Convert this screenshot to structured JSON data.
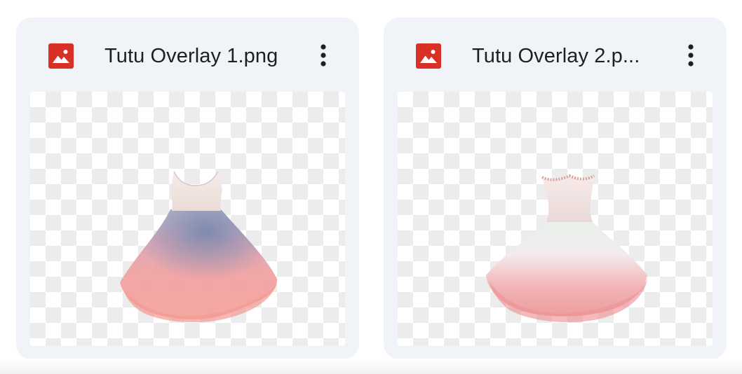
{
  "files": [
    {
      "name": "Tutu Overlay 1.png",
      "icon": "image-file-icon",
      "icon_color": "#d93025",
      "menu_icon": "more-vertical-icon"
    },
    {
      "name": "Tutu Overlay 2.p...",
      "icon": "image-file-icon",
      "icon_color": "#d93025",
      "menu_icon": "more-vertical-icon"
    }
  ],
  "colors": {
    "card_background": "#f0f4f9",
    "text": "#1f1f1f",
    "checker": "#ececec"
  }
}
